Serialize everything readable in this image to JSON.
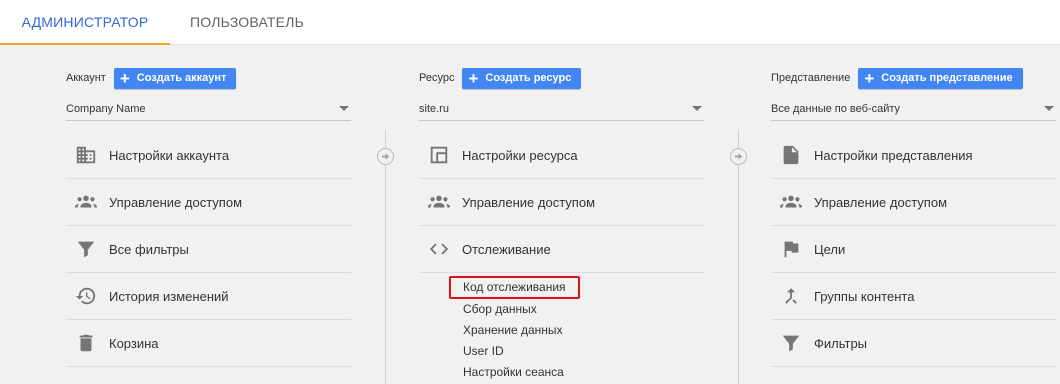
{
  "tabs": {
    "admin": "АДМИНИСТРАТОР",
    "user": "ПОЛЬЗОВАТЕЛЬ"
  },
  "account": {
    "label": "Аккаунт",
    "create_button": "Создать аккаунт",
    "selected": "Company Name",
    "items": [
      {
        "label": "Настройки аккаунта",
        "icon": "building-icon"
      },
      {
        "label": "Управление доступом",
        "icon": "people-icon"
      },
      {
        "label": "Все фильтры",
        "icon": "filter-icon"
      },
      {
        "label": "История изменений",
        "icon": "history-icon"
      },
      {
        "label": "Корзина",
        "icon": "trash-icon"
      }
    ]
  },
  "resource": {
    "label": "Ресурс",
    "create_button": "Создать ресурс",
    "selected": "site.ru",
    "items": [
      {
        "label": "Настройки ресурса",
        "icon": "window-icon"
      },
      {
        "label": "Управление доступом",
        "icon": "people-icon"
      },
      {
        "label": "Отслеживание",
        "icon": "code-icon"
      }
    ],
    "tracking_subitems": [
      "Код отслеживания",
      "Сбор данных",
      "Хранение данных",
      "User ID",
      "Настройки сеанса"
    ]
  },
  "view": {
    "label": "Представление",
    "create_button": "Создать представление",
    "selected": "Все данные по веб-сайту",
    "items": [
      {
        "label": "Настройки представления",
        "icon": "document-icon"
      },
      {
        "label": "Управление доступом",
        "icon": "people-icon"
      },
      {
        "label": "Цели",
        "icon": "flag-icon"
      },
      {
        "label": "Группы контента",
        "icon": "merge-icon"
      },
      {
        "label": "Фильтры",
        "icon": "filter-icon"
      }
    ]
  },
  "colors": {
    "accent_blue": "#4285f4",
    "tab_active": "#3367d6",
    "tab_underline": "#f4a02a",
    "highlight_red": "#e0101a"
  }
}
